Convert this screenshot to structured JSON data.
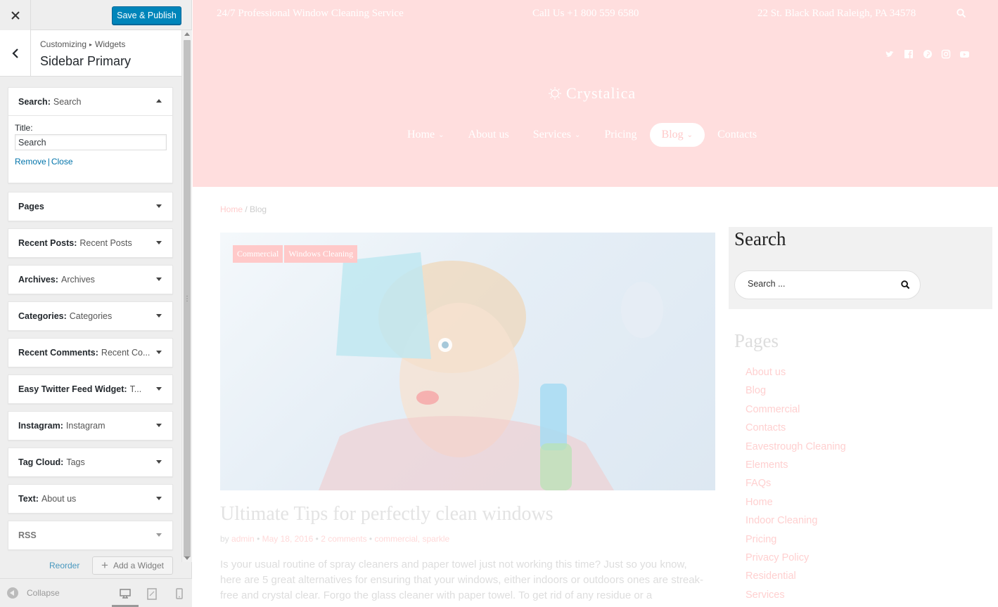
{
  "customizer": {
    "close_icon": "close-icon",
    "save_label": "Save & Publish",
    "breadcrumb": {
      "root": "Customizing",
      "section": "Widgets"
    },
    "panel_title": "Sidebar Primary",
    "search_widget": {
      "type": "Search:",
      "name": "Search",
      "title_label": "Title:",
      "title_value": "Search",
      "remove_label": "Remove",
      "separator": "|",
      "close_label": "Close"
    },
    "widgets": [
      {
        "type": "Pages",
        "name": ""
      },
      {
        "type": "Recent Posts:",
        "name": "Recent Posts"
      },
      {
        "type": "Archives:",
        "name": "Archives"
      },
      {
        "type": "Categories:",
        "name": "Categories"
      },
      {
        "type": "Recent Comments:",
        "name": "Recent Co..."
      },
      {
        "type": "Easy Twitter Feed Widget:",
        "name": "T..."
      },
      {
        "type": "Instagram:",
        "name": "Instagram"
      },
      {
        "type": "Tag Cloud:",
        "name": "Tags"
      },
      {
        "type": "Text:",
        "name": "About us"
      },
      {
        "type": "RSS",
        "name": ""
      }
    ],
    "reorder_label": "Reorder",
    "add_widget_label": "Add a Widget",
    "collapse_label": "Collapse"
  },
  "site": {
    "topbar": {
      "service": "24/7 Professional Window Cleaning Service",
      "phone": "Call Us +1 800 559 6580",
      "address": "22 St. Black Road Raleigh, PA 34578"
    },
    "logo": "Crystalica",
    "nav": [
      {
        "label": "Home",
        "chevron": "⌄"
      },
      {
        "label": "About us",
        "chevron": ""
      },
      {
        "label": "Services",
        "chevron": "⌄"
      },
      {
        "label": "Pricing",
        "chevron": ""
      },
      {
        "label": "Blog",
        "chevron": "⌄"
      },
      {
        "label": "Contacts",
        "chevron": ""
      }
    ],
    "crumbs": {
      "home": "Home",
      "sep": "/",
      "current": "Blog"
    },
    "post": {
      "tags": [
        "Commercial",
        "Windows Cleaning"
      ],
      "title": "Ultimate Tips for perfectly clean windows",
      "meta": {
        "by": "by",
        "author": "admin",
        "dot1": "•",
        "date": "May 18, 2016",
        "dot2": "•",
        "comments": "2 comments",
        "dot3": "•",
        "categories": "commercial, sparkle"
      },
      "excerpt": "Is your usual routine of spray cleaners and paper towel just not working this time? Just so you know, here are 5 great alternatives for ensuring that your windows, either indoors or outdoors ones are streak-free and crystal clear. Forgo the glass cleaner with paper towel. To get rid of any residue or a"
    },
    "sidebar": {
      "search_title": "Search",
      "search_placeholder": "Search ...",
      "pages_title": "Pages",
      "pages": [
        "About us",
        "Blog",
        "Commercial",
        "Contacts",
        "Eavestrough Cleaning",
        "Elements",
        "FAQs",
        "Home",
        "Indoor Cleaning",
        "Pricing",
        "Privacy Policy",
        "Residential",
        "Services"
      ]
    }
  },
  "colors": {
    "accent": "#0085ba",
    "hero_pink": "#ffdede",
    "link_pink": "#ffd0d0"
  }
}
